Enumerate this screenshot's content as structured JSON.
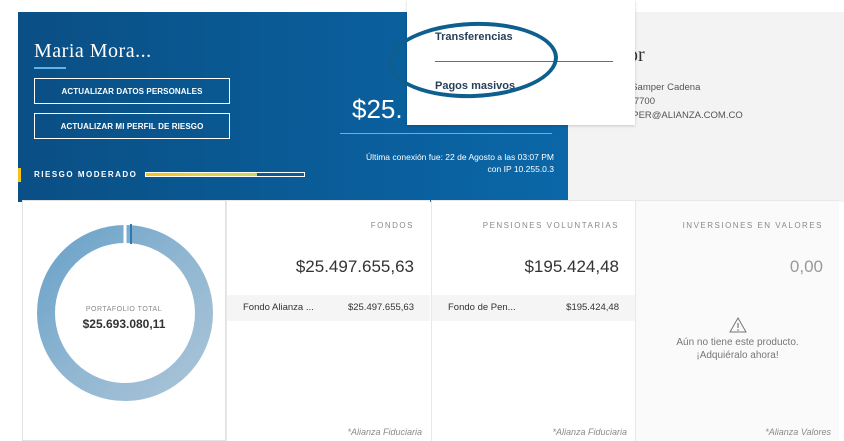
{
  "user": {
    "name": "Maria Mora...",
    "update_personal_label": "ACTUALIZAR DATOS PERSONALES",
    "update_risk_label": "ACTUALIZAR MI PERFIL DE RIESGO",
    "risk_label": "RIESGO MODERADO",
    "risk_level": 0.7,
    "balance_partial": "$25.",
    "last_connection_line1": "Última conexión fue: 22 de Agosto a las 03:07 PM",
    "last_connection_line2": "con IP 10.255.0.3"
  },
  "advisor": {
    "title_partial": "or",
    "name_partial": "ria Samper Cadena",
    "phone_partial": "6447700",
    "email_partial": "AMPER@ALIANZA.COM.CO"
  },
  "dropdown": {
    "items": [
      "Transferencias",
      "Pagos masivos"
    ]
  },
  "portfolio": {
    "label": "PORTAFOLIO TOTAL",
    "total": "$25.693.080,11"
  },
  "cards": {
    "fondos": {
      "title": "FONDOS",
      "amount": "$25.497.655,63",
      "product_name": "Fondo Alianza ...",
      "product_amount": "$25.497.655,63",
      "footer": "*Alianza Fiduciaria"
    },
    "pensiones": {
      "title": "PENSIONES VOLUNTARIAS",
      "amount": "$195.424,48",
      "product_name": "Fondo de Pen...",
      "product_amount": "$195.424,48",
      "footer": "*Alianza Fiduciaria"
    },
    "inversiones": {
      "title": "INVERSIONES EN VALORES",
      "amount": "0,00",
      "empty_line1": "Aún no tiene este producto.",
      "empty_line2": "¡Adquiéralo ahora!",
      "footer": "*Alianza Valores"
    }
  },
  "colors": {
    "brand_blue": "#0a5c98",
    "accent_blue": "#5fb2ea",
    "risk_yellow": "#f6c21c",
    "annotation": "#0e5f8d"
  },
  "icons": [
    "warning-icon"
  ]
}
